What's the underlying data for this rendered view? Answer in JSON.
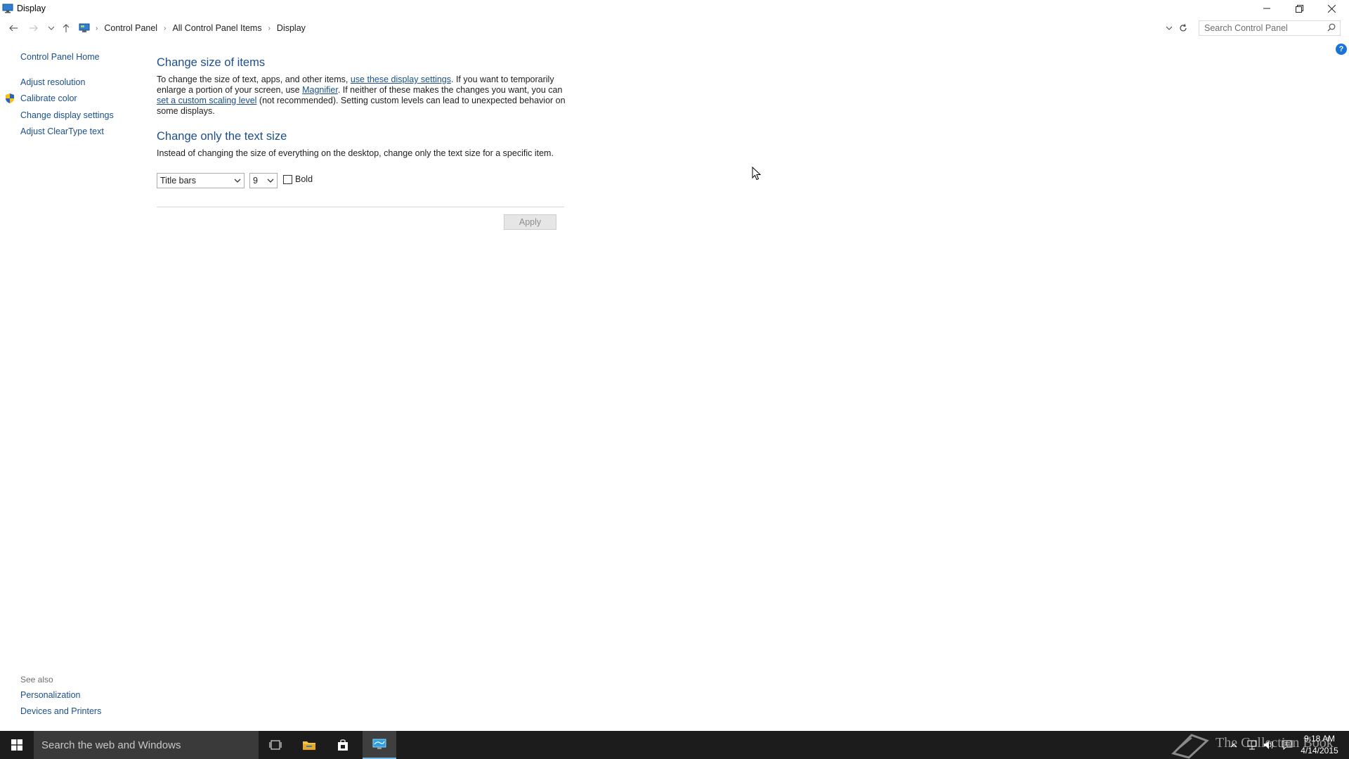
{
  "window": {
    "title": "Display"
  },
  "breadcrumb": [
    "Control Panel",
    "All Control Panel Items",
    "Display"
  ],
  "search": {
    "placeholder": "Search Control Panel"
  },
  "leftnav": {
    "home": "Control Panel Home",
    "items": [
      "Adjust resolution",
      "Calibrate color",
      "Change display settings",
      "Adjust ClearType text"
    ],
    "see_also_label": "See also",
    "see_also": [
      "Personalization",
      "Devices and Printers"
    ]
  },
  "section1": {
    "heading": "Change size of items",
    "p1": "To change the size of text, apps, and other items, ",
    "link1": "use these display settings",
    "p2": ".  If you want to temporarily enlarge a portion of your screen, use ",
    "link2": "Magnifier",
    "p3": ".  If neither of these makes the changes you want, you can ",
    "link3": "set a custom scaling level",
    "p4": " (not recommended).  Setting custom levels can lead to unexpected behavior on some displays."
  },
  "section2": {
    "heading": "Change only the text size",
    "description": "Instead of changing the size of everything on the desktop, change only the text size for a specific item.",
    "item_select": "Title bars",
    "size_select": "9",
    "bold_label": "Bold",
    "bold_checked": false
  },
  "apply_label": "Apply",
  "taskbar": {
    "search_placeholder": "Search the web and Windows",
    "wallpaper_text": "The Collection Book",
    "time": "9:18 AM",
    "date": "4/14/2015"
  },
  "colors": {
    "link": "#1a4f8c",
    "heading": "#1e4f8a",
    "taskbar": "#1c1c1c",
    "accent": "#76b9ed"
  }
}
